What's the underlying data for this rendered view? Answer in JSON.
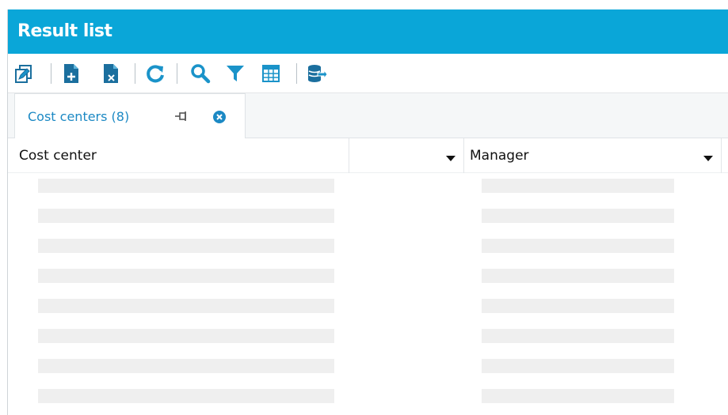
{
  "window": {
    "title": "Result list"
  },
  "toolbar": {
    "items": [
      {
        "icon": "edit-icon",
        "label": ""
      },
      {
        "icon": "new-document-icon",
        "label": ""
      },
      {
        "icon": "delete-document-icon",
        "label": ""
      },
      {
        "icon": "refresh-icon",
        "label": ""
      },
      {
        "icon": "search-icon",
        "label": ""
      },
      {
        "icon": "filter-icon",
        "label": ""
      },
      {
        "icon": "table-view-icon",
        "label": ""
      },
      {
        "icon": "database-export-icon",
        "label": ""
      }
    ]
  },
  "tabs": [
    {
      "label": "Cost centers (8)",
      "active": true
    }
  ],
  "grid": {
    "columns": [
      {
        "label": "Cost center"
      },
      {
        "label": "Manager"
      }
    ],
    "row_count": 8
  },
  "colors": {
    "title_bar": "#0aa6d8",
    "icon_primary": "#1a93c9",
    "icon_dark": "#1b6f9e",
    "tab_text": "#1c89c4",
    "placeholder": "#efefef"
  }
}
